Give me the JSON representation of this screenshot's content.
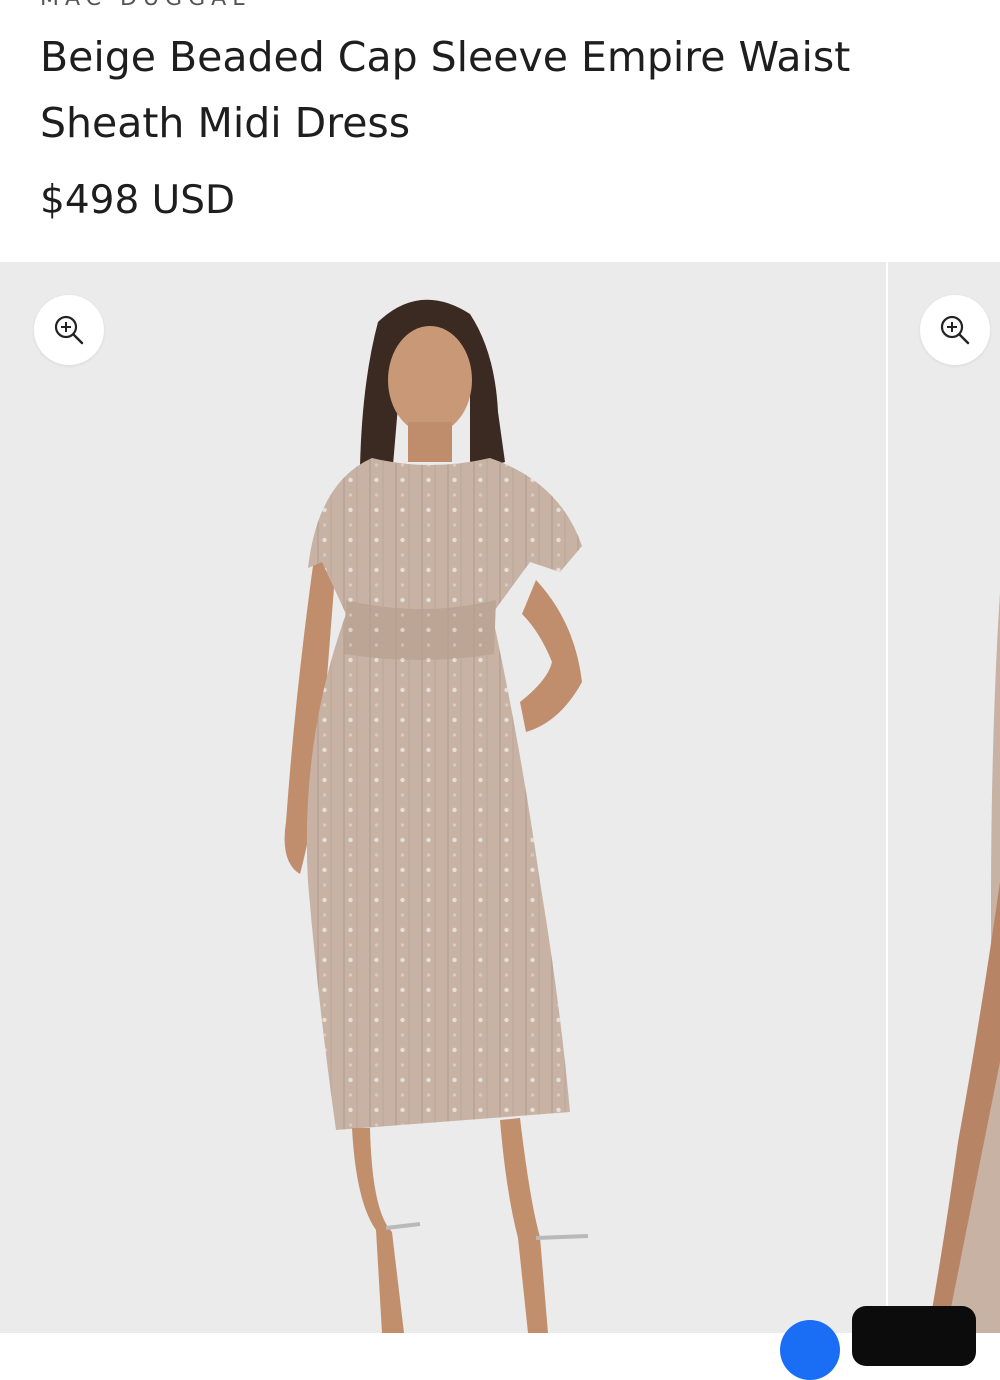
{
  "product": {
    "brand": "MAC DUGGAL",
    "title": "Beige Beaded Cap Sleeve Empire Waist Sheath Midi Dress",
    "price": "$498 USD"
  },
  "gallery": {
    "zoom_icon": "zoom-in-icon",
    "slides": [
      {
        "name": "model-front-photo",
        "dress_color": "#c8b2a3"
      },
      {
        "name": "model-alternate-photo",
        "dress_color": "#c8b2a3"
      }
    ]
  },
  "colors": {
    "background": "#ffffff",
    "photo_backdrop": "#ebebeb",
    "text": "#1e1e1e",
    "chat_button": "#1a6ef5"
  }
}
